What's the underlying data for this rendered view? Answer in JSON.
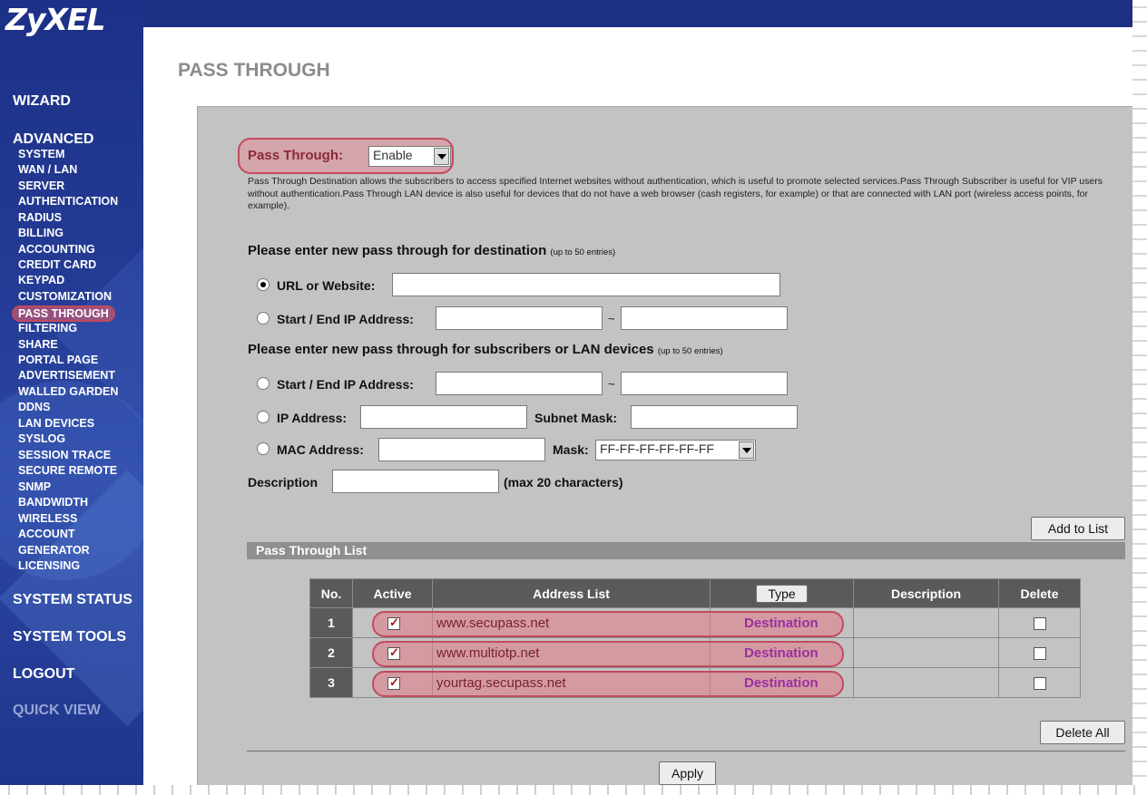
{
  "brand": "ZyXEL",
  "sidebar": {
    "wizard": "WIZARD",
    "advanced": "ADVANCED",
    "items": [
      "SYSTEM",
      "WAN / LAN",
      "SERVER",
      "AUTHENTICATION",
      "RADIUS",
      "BILLING",
      "ACCOUNTING",
      "CREDIT CARD",
      "KEYPAD",
      "CUSTOMIZATION",
      "PASS THROUGH",
      "FILTERING",
      "SHARE",
      "PORTAL PAGE",
      "ADVERTISEMENT",
      "WALLED GARDEN",
      "DDNS",
      "LAN DEVICES",
      "SYSLOG",
      "SESSION TRACE",
      "SECURE REMOTE",
      "SNMP",
      "BANDWIDTH",
      "WIRELESS",
      "ACCOUNT",
      "GENERATOR",
      "LICENSING"
    ],
    "system_status": "SYSTEM STATUS",
    "system_tools": "SYSTEM TOOLS",
    "logout": "LOGOUT",
    "quick_view": "QUICK VIEW"
  },
  "page": {
    "title": "PASS THROUGH",
    "pass_through_label": "Pass Through:",
    "pass_through_value": "Enable",
    "description": "Pass Through Destination allows the subscribers to access specified Internet websites without authentication, which is useful to promote selected services.Pass Through Subscriber is useful for VIP users without authentication.Pass Through LAN device is also useful for devices that do not have a web browser (cash registers, for example) or that are connected with LAN port (wireless access points, for example).",
    "dest_heading": "Please enter new pass through for destination",
    "dest_heading_note": "(up to 50 entries)",
    "url_label": "URL or Website:",
    "start_end_ip_label": "Start / End IP Address:",
    "tilde": "~",
    "sub_heading": "Please enter new pass through for subscribers or LAN devices",
    "sub_heading_note": "(up to 50 entries)",
    "ip_address_label": "IP Address:",
    "subnet_mask_label": "Subnet Mask:",
    "mac_address_label": "MAC Address:",
    "mask_label": "Mask:",
    "mask_value": "FF-FF-FF-FF-FF-FF",
    "description_label": "Description",
    "description_note": "(max 20 characters)",
    "add_to_list": "Add to List",
    "list_title": "Pass Through List",
    "delete_all": "Delete All",
    "apply": "Apply"
  },
  "table": {
    "headers": [
      "No.",
      "Active",
      "Address List",
      "Type",
      "Description",
      "Delete"
    ],
    "rows": [
      {
        "no": "1",
        "address": "www.secupass.net",
        "type": "Destination",
        "description": ""
      },
      {
        "no": "2",
        "address": "www.multiotp.net",
        "type": "Destination",
        "description": ""
      },
      {
        "no": "3",
        "address": "yourtag.secupass.net",
        "type": "Destination",
        "description": ""
      }
    ]
  },
  "colors": {
    "sidebar_blue": "#1d3087",
    "highlight_red": "#c24a5f",
    "panel_gray": "#c3c3c3",
    "destination_purple": "#9a2fa0"
  }
}
